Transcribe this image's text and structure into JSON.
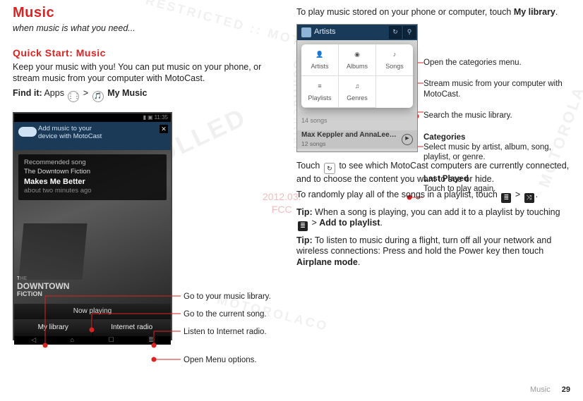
{
  "section": {
    "title": "Music",
    "tagline": "when music is what you need...",
    "quick_start_heading": "Quick Start: Music",
    "quick_start_body": "Keep your music with you! You can put music on your phone, or stream music from your computer with MotoCast.",
    "find_it_label": "Find it:",
    "find_it_path_1": "Apps",
    "find_it_sep": ">",
    "find_it_path_2": "My Music"
  },
  "phone": {
    "status_time": "11:35",
    "banner_line1": "Add music to your",
    "banner_line2": "device with MotoCast",
    "rec_label": "Recommended song",
    "rec_artist": "The Downtown Fiction",
    "rec_song": "Makes Me Better",
    "rec_time": "about two minutes ago",
    "cover_text_l1": "THE",
    "cover_text_l2": "DOWNTOWN",
    "cover_text_l3": "FiCTiON",
    "now_playing": "Now playing",
    "tab_library": "My library",
    "tab_radio": "Internet radio"
  },
  "left_callouts": {
    "c1": "Go to your music library.",
    "c2": "Go to the current song.",
    "c3": "Listen to Internet radio.",
    "c4": "Open Menu options."
  },
  "right_col": {
    "intro_1": "To play music stored on your phone or computer, touch ",
    "intro_bold": "My library",
    "period": ".",
    "middle_1": "Touch ",
    "middle_2": " to see which MotoCast computers are currently connected, and to choose the content you want to see or hide.",
    "random_1": "To randomly play all of the songs in a playlist, touch ",
    "random_2": " > ",
    "random_3": ".",
    "tip1_label": "Tip:",
    "tip1_1": " When a song is playing, you can add it to a playlist by touching ",
    "tip1_2": " > ",
    "tip1_bold": "Add to playlist",
    "tip2_label": "Tip:",
    "tip2_1": " To listen to music during a flight, turn off all your network and wireless connections: Press and hold the Power key then touch ",
    "tip2_bold": "Airplane mode"
  },
  "menu": {
    "titlebar": "Artists",
    "cat_artists": "Artists",
    "cat_albums": "Albums",
    "cat_songs": "Songs",
    "cat_playlists": "Playlists",
    "cat_genres": "Genres",
    "row1_sub": "14 songs",
    "row2_title": "Max Keppler and AnnaLee…",
    "row2_sub": "12 songs"
  },
  "right_callouts": {
    "r1": "Open the categories menu.",
    "r2": "Stream music from your computer with MotoCast.",
    "r3": "Search the music library.",
    "r4_bold": "Categories",
    "r4": "Select music by artist, album, song, playlist, or genre.",
    "r5_bold": "Last Played",
    "r5": "Touch to play again."
  },
  "center_stamp": {
    "l1": "2012.03.",
    "l2": "FCC"
  },
  "footer": {
    "section": "Music",
    "page": "29"
  }
}
